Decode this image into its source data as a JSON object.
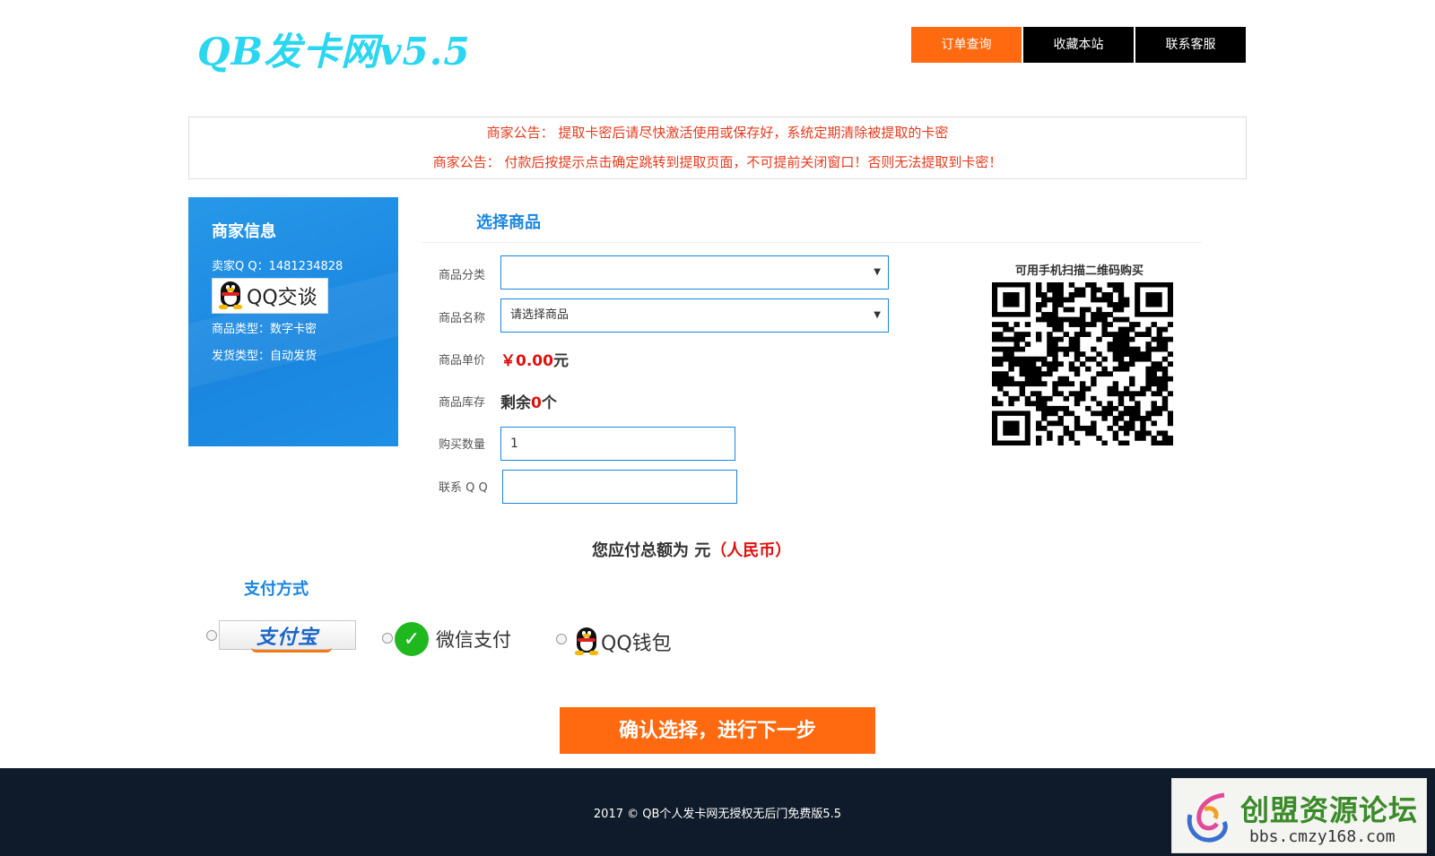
{
  "header": {
    "logo": "QB发卡网v5.5",
    "nav": [
      {
        "label": "订单查询",
        "active": true
      },
      {
        "label": "收藏本站",
        "active": false
      },
      {
        "label": "联系客服",
        "active": false
      }
    ]
  },
  "notice": {
    "line1": "商家公告： 提取卡密后请尽快激活使用或保存好，系统定期清除被提取的卡密",
    "line2": "商家公告： 付款后按提示点击确定跳转到提取页面，不可提前关闭窗口！否则无法提取到卡密！"
  },
  "merchant": {
    "title": "商家信息",
    "qq": "卖家Q Q：1481234828",
    "qq_button_label": "QQ交谈",
    "goods_type": "商品类型：数字卡密",
    "delivery_type": "发货类型：自动发货"
  },
  "product": {
    "section_title": "选择商品",
    "category_label": "商品分类",
    "category_value": "",
    "name_label": "商品名称",
    "name_value": "请选择商品",
    "price_label": "商品单价",
    "price_value": "￥0.00",
    "price_unit": "元",
    "stock_label": "商品库存",
    "stock_prefix": "剩余",
    "stock_value": "0",
    "stock_suffix": "个",
    "quantity_label": "购买数量",
    "quantity_value": "1",
    "contact_label": "联系 Q Q",
    "contact_value": ""
  },
  "qr": {
    "label": "可用手机扫描二维码购买"
  },
  "total": {
    "prefix": "您应付总额为 元",
    "currency": "（人民币）"
  },
  "payment": {
    "title": "支付方式",
    "alipay_label": "支付宝",
    "wechat_label": "微信支付",
    "qqwallet_label": "QQ钱包"
  },
  "submit_label": "确认选择，进行下一步",
  "footer": {
    "copyright": "2017 © QB个人发卡网无授权无后门免费版5.5"
  },
  "watermark": {
    "title": "创盟资源论坛",
    "url": "bbs.cmzy168.com"
  },
  "colors": {
    "accent_orange": "#ff6a10",
    "accent_blue": "#1a86e0",
    "notice_red": "#e53b1d",
    "footer_bg": "#0f1b2a"
  }
}
